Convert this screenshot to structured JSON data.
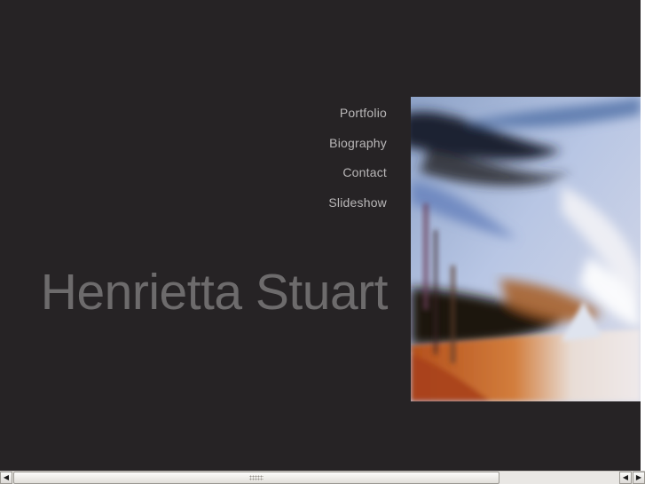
{
  "nav": {
    "items": [
      {
        "label": "Portfolio"
      },
      {
        "label": "Biography"
      },
      {
        "label": "Contact"
      },
      {
        "label": "Slideshow"
      }
    ]
  },
  "artist": {
    "name": "Henrietta Stuart"
  },
  "colors": {
    "background": "#262325",
    "nav_text": "#b9b7b8",
    "name_text": "#6d6b6c"
  },
  "scrollbar": {
    "left_arrow": "◀",
    "right_arrow": "▶",
    "left_arrow_icon": "chevron-left-icon",
    "right_arrow_icon": "chevron-right-icon"
  }
}
